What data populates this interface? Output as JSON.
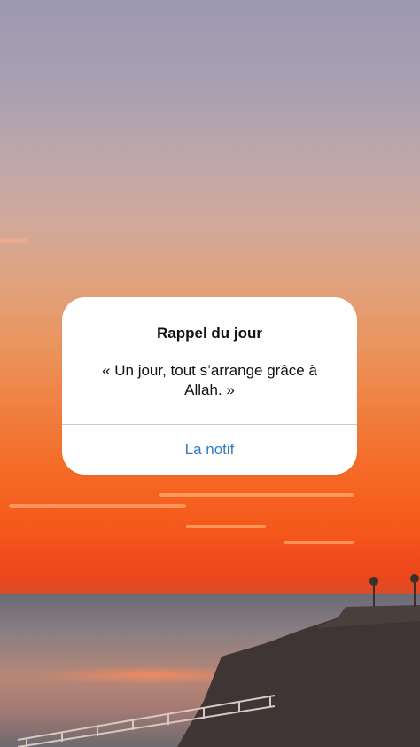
{
  "dialog": {
    "title": "Rappel du jour",
    "message": "« Un jour, tout s’arrange grâce à Allah. »",
    "action_label": "La notif"
  },
  "colors": {
    "action": "#2f7bc4",
    "sky_top": "#9d99b0",
    "sunset": "#f55a1c"
  }
}
